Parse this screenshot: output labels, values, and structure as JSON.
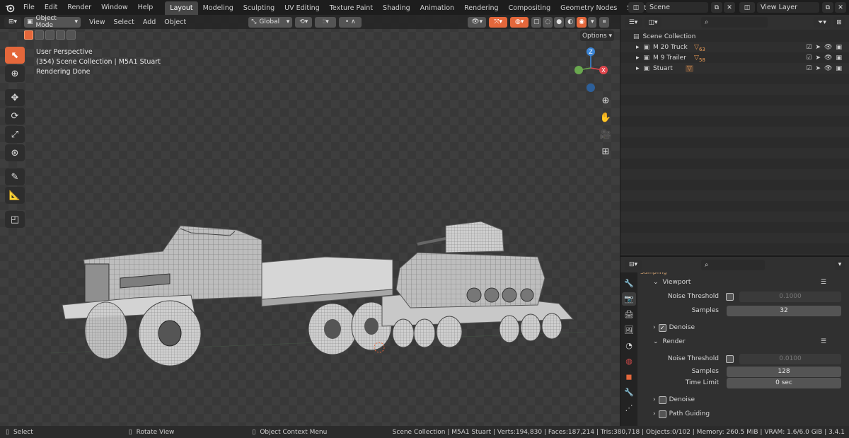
{
  "topbar": {
    "menus": [
      "File",
      "Edit",
      "Render",
      "Window",
      "Help"
    ],
    "workspaces": [
      "Layout",
      "Modeling",
      "Sculpting",
      "UV Editing",
      "Texture Paint",
      "Shading",
      "Animation",
      "Rendering",
      "Compositing",
      "Geometry Nodes",
      "Scripting"
    ],
    "active_workspace": "Layout",
    "scene_value": "Scene",
    "view_layer_value": "View Layer"
  },
  "viewport": {
    "mode": "Object Mode",
    "menus": [
      "View",
      "Select",
      "Add",
      "Object"
    ],
    "transform_orientation": "Global",
    "options_label": "Options",
    "overlay_lines": [
      "User Perspective",
      "(354) Scene Collection | M5A1 Stuart",
      "Rendering Done"
    ],
    "gizmo": {
      "z": "Z",
      "x": "X"
    }
  },
  "outliner": {
    "root": "Scene Collection",
    "items": [
      {
        "name": "M 20 Truck",
        "badge": "63"
      },
      {
        "name": "M 9 Trailer",
        "badge": "58"
      },
      {
        "name": "Stuart",
        "badge": ""
      }
    ]
  },
  "properties": {
    "section_partial": "Sampling",
    "viewport_panel": "Viewport",
    "render_panel": "Render",
    "noise_threshold_label": "Noise Threshold",
    "samples_label": "Samples",
    "time_limit_label": "Time Limit",
    "denoise_label": "Denoise",
    "path_guiding_label": "Path Guiding",
    "viewport_noise_threshold": "0.1000",
    "viewport_samples": "32",
    "render_noise_threshold": "0.0100",
    "render_samples": "128",
    "render_time_limit": "0 sec"
  },
  "statusbar": {
    "select": "Select",
    "rotate": "Rotate View",
    "context": "Object Context Menu",
    "stats": "Scene Collection | M5A1 Stuart | Verts:194,830 | Faces:187,214 | Tris:380,718 | Objects:0/102 | Memory: 260.5 MiB | VRAM: 1.6/6.0 GiB | 3.4.1"
  },
  "colors": {
    "accent": "#e4673b",
    "axis_x": "#e0464d",
    "axis_y": "#6aa84f",
    "axis_z": "#3b85d6"
  }
}
